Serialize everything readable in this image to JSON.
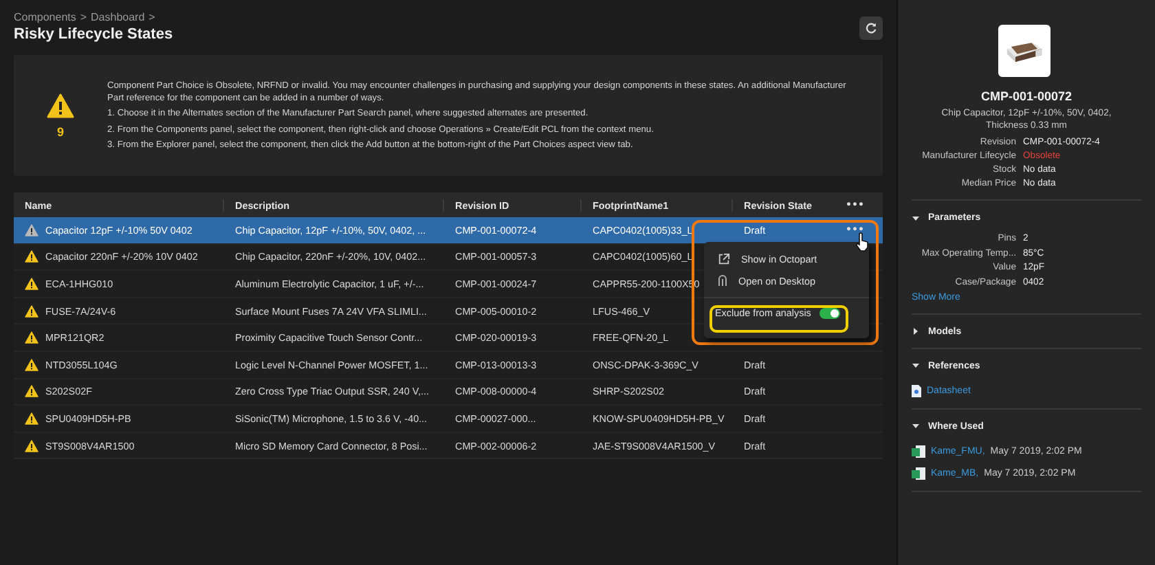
{
  "breadcrumb": {
    "items": [
      "Components",
      "Dashboard"
    ],
    "separator": ">"
  },
  "title": "Risky Lifecycle States",
  "info": {
    "count": "9",
    "message": "Component Part Choice is Obsolete, NRFND or invalid. You may encounter challenges in purchasing and supplying your design components in these states. An additional Manufacturer Part reference for the component can be added in a number of ways.",
    "steps": [
      "1. Choose it in the Alternates section of the Manufacturer Part Search panel, where suggested alternates are presented.",
      "2. From the Components panel, select the component, then right-click and choose Operations » Create/Edit PCL from the context menu.",
      "3. From the Explorer panel, select the component, then click the Add button at the bottom-right of the Part Choices aspect view tab."
    ]
  },
  "table": {
    "columns": [
      "Name",
      "Description",
      "Revision ID",
      "FootprintName1",
      "Revision State"
    ],
    "more": "•••",
    "rows": [
      {
        "name": "Capacitor 12pF +/-10% 50V 0402",
        "description": "Chip Capacitor, 12pF +/-10%, 50V, 0402, ...",
        "revision_id": "CMP-001-00072-4",
        "footprint": "CAPC0402(1005)33_L",
        "state": "Draft",
        "selected": true
      },
      {
        "name": "Capacitor 220nF +/-20% 10V 0402",
        "description": "Chip Capacitor, 220nF +/-20%, 10V, 0402...",
        "revision_id": "CMP-001-00057-3",
        "footprint": "CAPC0402(1005)60_L",
        "selected": false
      },
      {
        "name": "ECA-1HHG010",
        "description": "Aluminum Electrolytic Capacitor, 1 uF, +/-...",
        "revision_id": "CMP-001-00024-7",
        "footprint": "CAPPR55-200-1100X50",
        "selected": false
      },
      {
        "name": "FUSE-7A/24V-6",
        "description": "Surface Mount Fuses 7A 24V VFA SLIMLI...",
        "revision_id": "CMP-005-00010-2",
        "footprint": "LFUS-466_V",
        "selected": false
      },
      {
        "name": "MPR121QR2",
        "description": "Proximity Capacitive Touch Sensor Contr...",
        "revision_id": "CMP-020-00019-3",
        "footprint": "FREE-QFN-20_L",
        "selected": false
      },
      {
        "name": "NTD3055L104G",
        "description": "Logic Level N-Channel Power MOSFET, 1...",
        "revision_id": "CMP-013-00013-3",
        "footprint": "ONSC-DPAK-3-369C_V",
        "state": "Draft",
        "selected": false
      },
      {
        "name": "S202S02F",
        "description": "Zero Cross Type Triac Output SSR, 240 V,...",
        "revision_id": "CMP-008-00000-4",
        "footprint": "SHRP-S202S02",
        "state": "Draft",
        "selected": false
      },
      {
        "name": "SPU0409HD5H-PB",
        "description": "SiSonic(TM) Microphone, 1.5 to 3.6 V, -40...",
        "revision_id": "CMP-00027-000...",
        "footprint": "KNOW-SPU0409HD5H-PB_V",
        "state": "Draft",
        "selected": false
      },
      {
        "name": "ST9S008V4AR1500",
        "description": "Micro SD Memory Card Connector, 8 Posi...",
        "revision_id": "CMP-002-00006-2",
        "footprint": "JAE-ST9S008V4AR1500_V",
        "state": "Draft",
        "selected": false
      }
    ]
  },
  "context_menu": {
    "items": [
      {
        "label": "Show in Octopart",
        "kind": "external"
      },
      {
        "label": "Open on Desktop",
        "kind": "desktop"
      }
    ],
    "toggle": {
      "label": "Exclude from analysis",
      "on": true
    }
  },
  "details": {
    "title": "CMP-001-00072",
    "description": "Chip Capacitor, 12pF +/-10%, 50V, 0402, Thickness 0.33 mm",
    "properties": [
      {
        "label": "Revision",
        "value": "CMP-001-00072-4",
        "kind": "plain"
      },
      {
        "label": "Manufacturer Lifecycle",
        "value": "Obsolete",
        "kind": "alert"
      },
      {
        "label": "Stock",
        "value": "No data",
        "kind": "plain"
      },
      {
        "label": "Median Price",
        "value": "No data",
        "kind": "plain"
      }
    ],
    "parameters": {
      "title": "Parameters",
      "expanded": true,
      "rows": [
        {
          "label": "Pins",
          "value": "2"
        },
        {
          "label": "Max Operating Temp...",
          "value": "85°C"
        },
        {
          "label": "Value",
          "value": "12pF"
        },
        {
          "label": "Case/Package",
          "value": "0402"
        }
      ],
      "show_more": "Show More"
    },
    "models": {
      "title": "Models",
      "expanded": false
    },
    "references": {
      "title": "References",
      "expanded": true,
      "links": [
        "Datasheet"
      ]
    },
    "where_used": {
      "title": "Where Used",
      "expanded": true,
      "items": [
        {
          "link": "Kame_FMU,",
          "date": "May 7 2019, 2:02 PM"
        },
        {
          "link": "Kame_MB,",
          "date": "May 7 2019, 2:02 PM"
        }
      ]
    }
  }
}
